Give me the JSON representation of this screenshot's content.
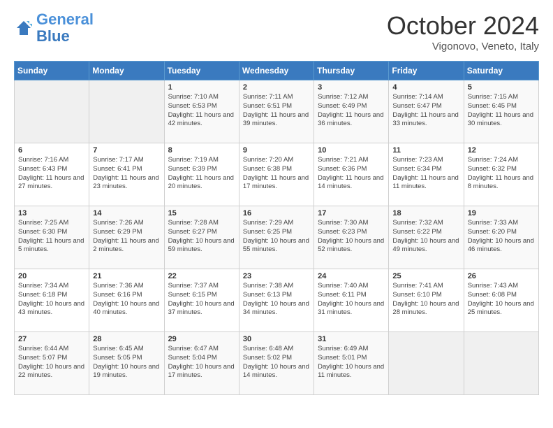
{
  "logo": {
    "line1": "General",
    "line2": "Blue"
  },
  "title": "October 2024",
  "subtitle": "Vigonovo, Veneto, Italy",
  "days_of_week": [
    "Sunday",
    "Monday",
    "Tuesday",
    "Wednesday",
    "Thursday",
    "Friday",
    "Saturday"
  ],
  "weeks": [
    [
      {
        "num": "",
        "empty": true
      },
      {
        "num": "",
        "empty": true
      },
      {
        "num": "1",
        "sunrise": "Sunrise: 7:10 AM",
        "sunset": "Sunset: 6:53 PM",
        "daylight": "Daylight: 11 hours and 42 minutes."
      },
      {
        "num": "2",
        "sunrise": "Sunrise: 7:11 AM",
        "sunset": "Sunset: 6:51 PM",
        "daylight": "Daylight: 11 hours and 39 minutes."
      },
      {
        "num": "3",
        "sunrise": "Sunrise: 7:12 AM",
        "sunset": "Sunset: 6:49 PM",
        "daylight": "Daylight: 11 hours and 36 minutes."
      },
      {
        "num": "4",
        "sunrise": "Sunrise: 7:14 AM",
        "sunset": "Sunset: 6:47 PM",
        "daylight": "Daylight: 11 hours and 33 minutes."
      },
      {
        "num": "5",
        "sunrise": "Sunrise: 7:15 AM",
        "sunset": "Sunset: 6:45 PM",
        "daylight": "Daylight: 11 hours and 30 minutes."
      }
    ],
    [
      {
        "num": "6",
        "sunrise": "Sunrise: 7:16 AM",
        "sunset": "Sunset: 6:43 PM",
        "daylight": "Daylight: 11 hours and 27 minutes."
      },
      {
        "num": "7",
        "sunrise": "Sunrise: 7:17 AM",
        "sunset": "Sunset: 6:41 PM",
        "daylight": "Daylight: 11 hours and 23 minutes."
      },
      {
        "num": "8",
        "sunrise": "Sunrise: 7:19 AM",
        "sunset": "Sunset: 6:39 PM",
        "daylight": "Daylight: 11 hours and 20 minutes."
      },
      {
        "num": "9",
        "sunrise": "Sunrise: 7:20 AM",
        "sunset": "Sunset: 6:38 PM",
        "daylight": "Daylight: 11 hours and 17 minutes."
      },
      {
        "num": "10",
        "sunrise": "Sunrise: 7:21 AM",
        "sunset": "Sunset: 6:36 PM",
        "daylight": "Daylight: 11 hours and 14 minutes."
      },
      {
        "num": "11",
        "sunrise": "Sunrise: 7:23 AM",
        "sunset": "Sunset: 6:34 PM",
        "daylight": "Daylight: 11 hours and 11 minutes."
      },
      {
        "num": "12",
        "sunrise": "Sunrise: 7:24 AM",
        "sunset": "Sunset: 6:32 PM",
        "daylight": "Daylight: 11 hours and 8 minutes."
      }
    ],
    [
      {
        "num": "13",
        "sunrise": "Sunrise: 7:25 AM",
        "sunset": "Sunset: 6:30 PM",
        "daylight": "Daylight: 11 hours and 5 minutes."
      },
      {
        "num": "14",
        "sunrise": "Sunrise: 7:26 AM",
        "sunset": "Sunset: 6:29 PM",
        "daylight": "Daylight: 11 hours and 2 minutes."
      },
      {
        "num": "15",
        "sunrise": "Sunrise: 7:28 AM",
        "sunset": "Sunset: 6:27 PM",
        "daylight": "Daylight: 10 hours and 59 minutes."
      },
      {
        "num": "16",
        "sunrise": "Sunrise: 7:29 AM",
        "sunset": "Sunset: 6:25 PM",
        "daylight": "Daylight: 10 hours and 55 minutes."
      },
      {
        "num": "17",
        "sunrise": "Sunrise: 7:30 AM",
        "sunset": "Sunset: 6:23 PM",
        "daylight": "Daylight: 10 hours and 52 minutes."
      },
      {
        "num": "18",
        "sunrise": "Sunrise: 7:32 AM",
        "sunset": "Sunset: 6:22 PM",
        "daylight": "Daylight: 10 hours and 49 minutes."
      },
      {
        "num": "19",
        "sunrise": "Sunrise: 7:33 AM",
        "sunset": "Sunset: 6:20 PM",
        "daylight": "Daylight: 10 hours and 46 minutes."
      }
    ],
    [
      {
        "num": "20",
        "sunrise": "Sunrise: 7:34 AM",
        "sunset": "Sunset: 6:18 PM",
        "daylight": "Daylight: 10 hours and 43 minutes."
      },
      {
        "num": "21",
        "sunrise": "Sunrise: 7:36 AM",
        "sunset": "Sunset: 6:16 PM",
        "daylight": "Daylight: 10 hours and 40 minutes."
      },
      {
        "num": "22",
        "sunrise": "Sunrise: 7:37 AM",
        "sunset": "Sunset: 6:15 PM",
        "daylight": "Daylight: 10 hours and 37 minutes."
      },
      {
        "num": "23",
        "sunrise": "Sunrise: 7:38 AM",
        "sunset": "Sunset: 6:13 PM",
        "daylight": "Daylight: 10 hours and 34 minutes."
      },
      {
        "num": "24",
        "sunrise": "Sunrise: 7:40 AM",
        "sunset": "Sunset: 6:11 PM",
        "daylight": "Daylight: 10 hours and 31 minutes."
      },
      {
        "num": "25",
        "sunrise": "Sunrise: 7:41 AM",
        "sunset": "Sunset: 6:10 PM",
        "daylight": "Daylight: 10 hours and 28 minutes."
      },
      {
        "num": "26",
        "sunrise": "Sunrise: 7:43 AM",
        "sunset": "Sunset: 6:08 PM",
        "daylight": "Daylight: 10 hours and 25 minutes."
      }
    ],
    [
      {
        "num": "27",
        "sunrise": "Sunrise: 6:44 AM",
        "sunset": "Sunset: 5:07 PM",
        "daylight": "Daylight: 10 hours and 22 minutes."
      },
      {
        "num": "28",
        "sunrise": "Sunrise: 6:45 AM",
        "sunset": "Sunset: 5:05 PM",
        "daylight": "Daylight: 10 hours and 19 minutes."
      },
      {
        "num": "29",
        "sunrise": "Sunrise: 6:47 AM",
        "sunset": "Sunset: 5:04 PM",
        "daylight": "Daylight: 10 hours and 17 minutes."
      },
      {
        "num": "30",
        "sunrise": "Sunrise: 6:48 AM",
        "sunset": "Sunset: 5:02 PM",
        "daylight": "Daylight: 10 hours and 14 minutes."
      },
      {
        "num": "31",
        "sunrise": "Sunrise: 6:49 AM",
        "sunset": "Sunset: 5:01 PM",
        "daylight": "Daylight: 10 hours and 11 minutes."
      },
      {
        "num": "",
        "empty": true
      },
      {
        "num": "",
        "empty": true
      }
    ]
  ]
}
